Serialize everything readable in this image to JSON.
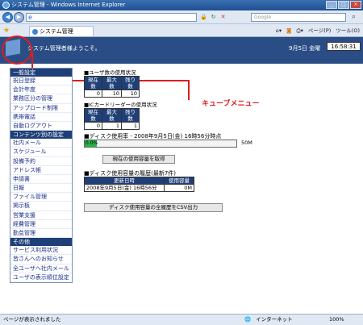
{
  "window": {
    "title": "システム管理 - Windows Internet Explorer"
  },
  "browser": {
    "address_placeholder": "",
    "search_placeholder": "Google",
    "tab_label": "システム管理",
    "toolbar": {
      "page": "ページ(P)",
      "tools": "ツール(O)"
    }
  },
  "header": {
    "welcome": "システム管理者様ようこそ。",
    "date": "9月5日 金曜",
    "clock": "16:58:31"
  },
  "annotation": {
    "label": "キューブメニュー"
  },
  "sidebar": {
    "general": {
      "title": "一般設定",
      "items": [
        "祝日登録",
        "会計年度",
        "業務区分の管理",
        "アップロード制限",
        "携帯電話",
        "自動ログアウト"
      ]
    },
    "contents": {
      "title": "コンテンツ別の設定",
      "items": [
        "社内メール",
        "スケジュール",
        "設備予約",
        "アドレス帳",
        "申請書",
        "日報",
        "ファイル管理",
        "掲示板",
        "営業支援",
        "経費管理",
        "勤怠管理"
      ]
    },
    "others": {
      "title": "その他",
      "items": [
        "サービス利用状況",
        "皆さんへのお知らせ",
        "全ユーザへ社内メール",
        "ユーザの表示順位設定"
      ]
    }
  },
  "users": {
    "title": "■ユーザ数の使用状況",
    "headers": [
      "現在数",
      "最大数",
      "残り数"
    ],
    "values": [
      "0",
      "10",
      "10"
    ]
  },
  "icreader": {
    "title": "■ICカードリーダーの使用状況",
    "headers": [
      "現在数",
      "最大数",
      "残り数"
    ],
    "values": [
      "0",
      "1",
      "1"
    ]
  },
  "disk": {
    "title": "■ディスク使用率 - 2008年9月5日(金) 16時56分時点",
    "percent": "0.0%",
    "percent_value": 0.0,
    "capacity": "50M",
    "button": "現在の使用容量を取得"
  },
  "history": {
    "title": "■ディスク使用容量の履歴(最新7件)",
    "headers": [
      "更新日時",
      "使用容量"
    ],
    "rows": [
      [
        "2008年9月5日(金) 16時56分",
        "0M"
      ]
    ],
    "button": "ディスク使用容量の全履歴をCSV出力"
  },
  "status": {
    "left": "ページが表示されました",
    "zone": "インターネット",
    "zoom": "100%"
  }
}
